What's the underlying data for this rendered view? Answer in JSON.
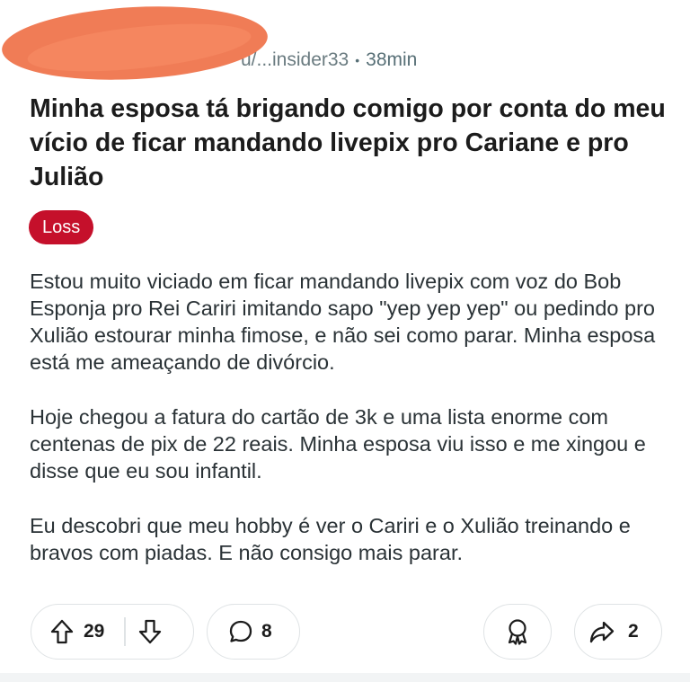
{
  "post": {
    "username": "u/...insider33",
    "time": "38min",
    "title": "Minha esposa tá brigando comigo por conta do meu vício de ficar mandando livepix pro Cariane e pro Julião",
    "flair": "Loss",
    "paragraphs": [
      "Estou muito viciado em ficar mandando livepix com voz do Bob Esponja pro Rei Cariri imitando sapo \"yep yep yep\" ou pedindo pro Xulião estourar minha fimose, e não sei como parar. Minha esposa está me ameaçando de divórcio.",
      "Hoje chegou a fatura do cartão de 3k e uma lista enorme com centenas de pix de 22 reais. Minha esposa viu isso e me xingou e disse que eu sou infantil.",
      "Eu descobri que meu hobby é ver o Cariri e o Xulião treinando e bravos com piadas. E não consigo mais parar."
    ]
  },
  "actions": {
    "upvotes": "29",
    "comments": "8",
    "shares": "2"
  },
  "icons": {
    "upvote": "upvote-arrow-icon",
    "downvote": "downvote-arrow-icon",
    "comment": "comment-bubble-icon",
    "award": "award-ribbon-icon",
    "share": "share-arrow-icon"
  },
  "colors": {
    "flair_bg": "#c5102b",
    "redaction": "#f07c56",
    "meta_text": "#576f76"
  }
}
